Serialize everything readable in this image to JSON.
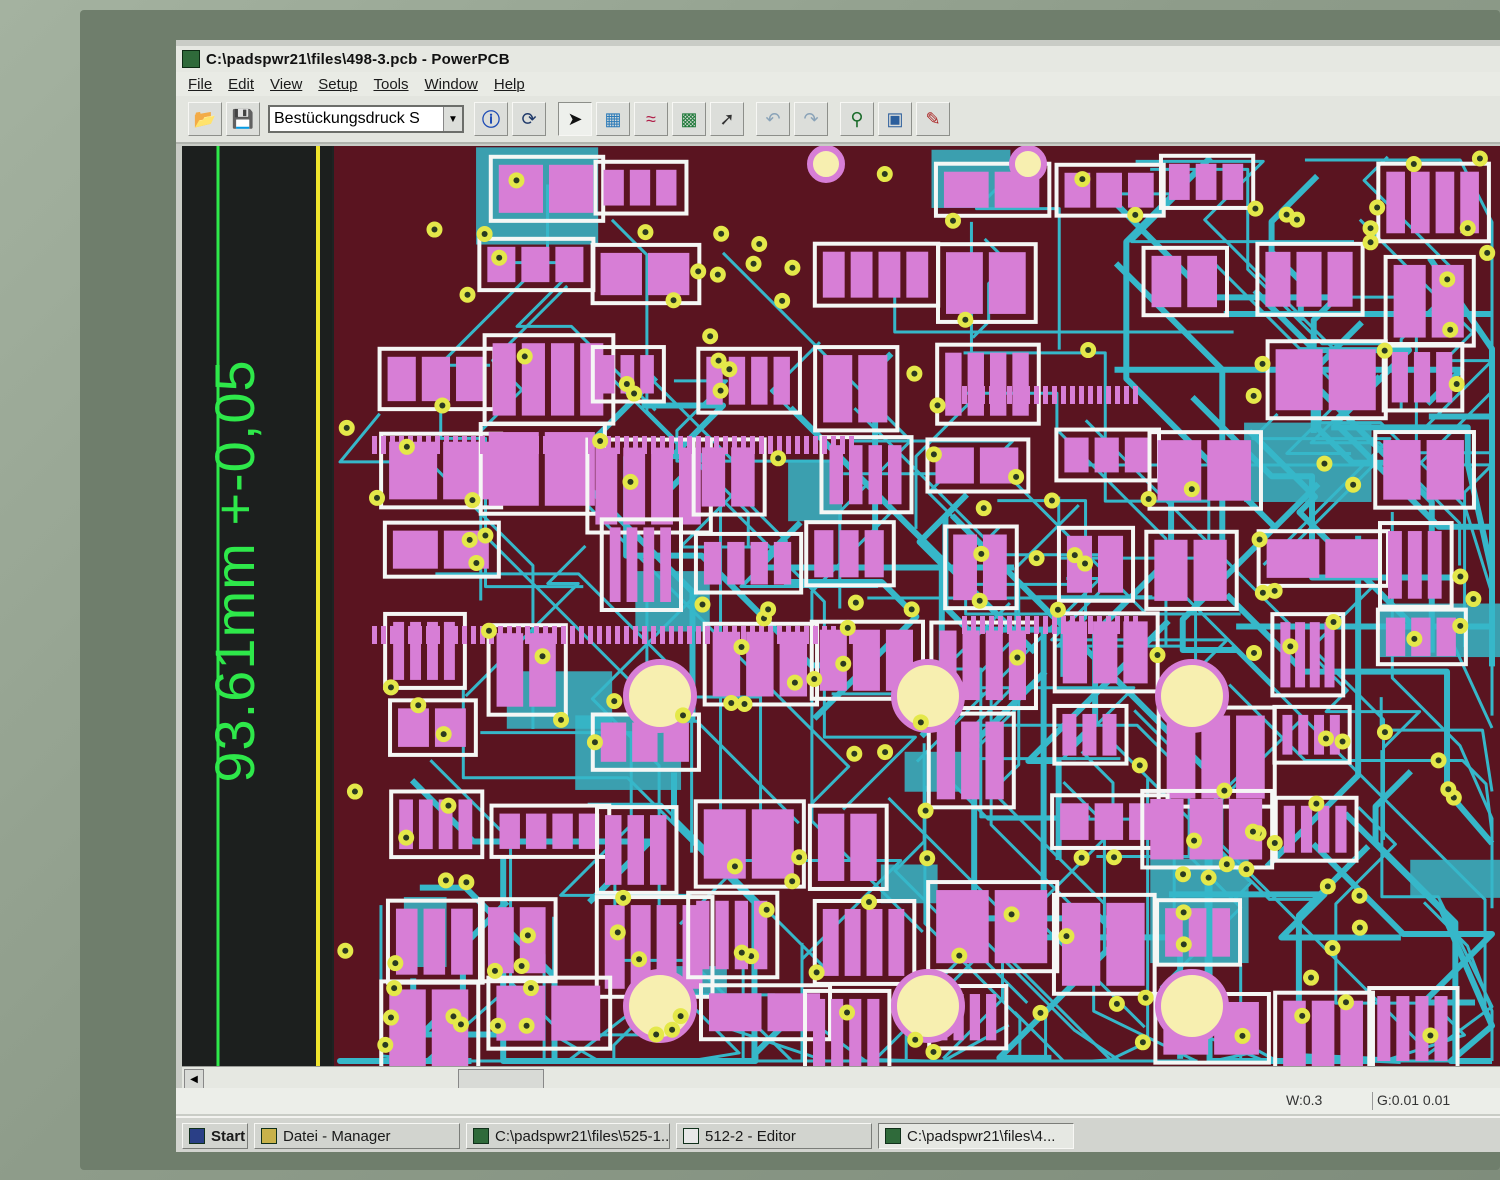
{
  "window": {
    "title": "C:\\padspwr21\\files\\498-3.pcb - PowerPCB"
  },
  "menu": [
    "File",
    "Edit",
    "View",
    "Setup",
    "Tools",
    "Window",
    "Help"
  ],
  "toolbar": {
    "layer_select_value": "Bestückungsdruck S",
    "buttons": [
      "open-icon",
      "save-icon",
      "info-icon",
      "redraw-icon",
      "select-arrow-icon",
      "drafting-icon",
      "design-icon",
      "ecogate-icon",
      "route-icon",
      "undo-icon",
      "redo-icon",
      "zoom-icon",
      "view-icon",
      "report-icon"
    ]
  },
  "canvas": {
    "dimension_label": "93.61mm +-0,05",
    "colors": {
      "board": "#5a1420",
      "pads": "#d77ed6",
      "traces": "#36b7c9",
      "vias": "#e4e84a",
      "outline": "#f5f7f5",
      "dimension": "#2ee84a",
      "board_edge": "#f0e42c"
    }
  },
  "status": {
    "w": "W:0.3",
    "g": "G:0.01 0.01"
  },
  "taskbar": {
    "start": "Start",
    "tasks": [
      {
        "label": "Datei - Manager",
        "active": false
      },
      {
        "label": "C:\\padspwr21\\files\\525-1...",
        "active": false
      },
      {
        "label": "512-2 - Editor",
        "active": false
      },
      {
        "label": "C:\\padspwr21\\files\\4...",
        "active": true
      }
    ]
  }
}
